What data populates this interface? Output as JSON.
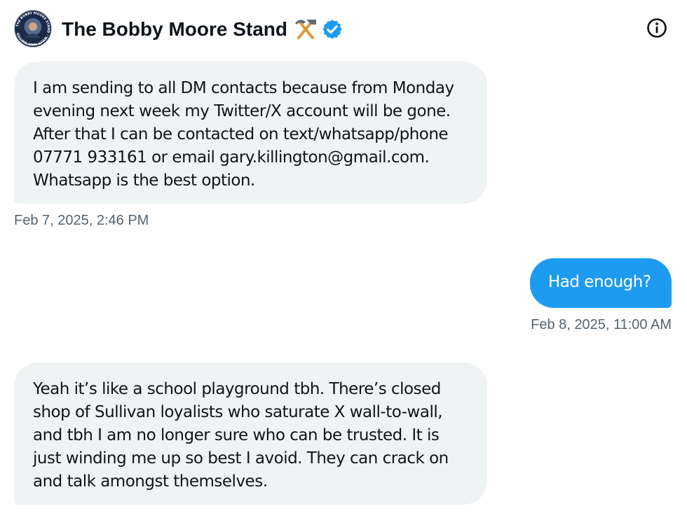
{
  "header": {
    "contact_name": "The Bobby Moore Stand",
    "emoji_icon": "hammer-and-pick-icon",
    "verified_icon": "verified-badge-icon",
    "info_icon": "info-icon",
    "avatar_text": "THE BOBBY MOORE STAND · WEST HAM UNITED"
  },
  "messages": [
    {
      "direction": "incoming",
      "lines": [
        "I am sending to all DM contacts because from Monday",
        "evening next week my Twitter/X account will be gone.",
        "After that I can be contacted on text/whatsapp/phone",
        "07771 933161 or email gary.killington@gmail.com.",
        "Whatsapp is the best option."
      ],
      "timestamp": "Feb 7, 2025, 2:46 PM"
    },
    {
      "direction": "outgoing",
      "lines": [
        "Had enough?"
      ],
      "timestamp": "Feb 8, 2025, 11:00 AM"
    },
    {
      "direction": "incoming",
      "lines": [
        "Yeah it’s like a school playground tbh. There’s closed",
        "shop of Sullivan loyalists who saturate X wall-to-wall,",
        "and tbh I am no longer sure who can be trusted. It is",
        "just winding me up so best I avoid. They can crack on",
        "and talk amongst themselves."
      ]
    }
  ],
  "colors": {
    "incoming_bubble": "#eff3f4",
    "outgoing_bubble": "#1d9bf0",
    "verified": "#1d9bf0",
    "timestamp": "#536471",
    "text": "#0f1419"
  }
}
